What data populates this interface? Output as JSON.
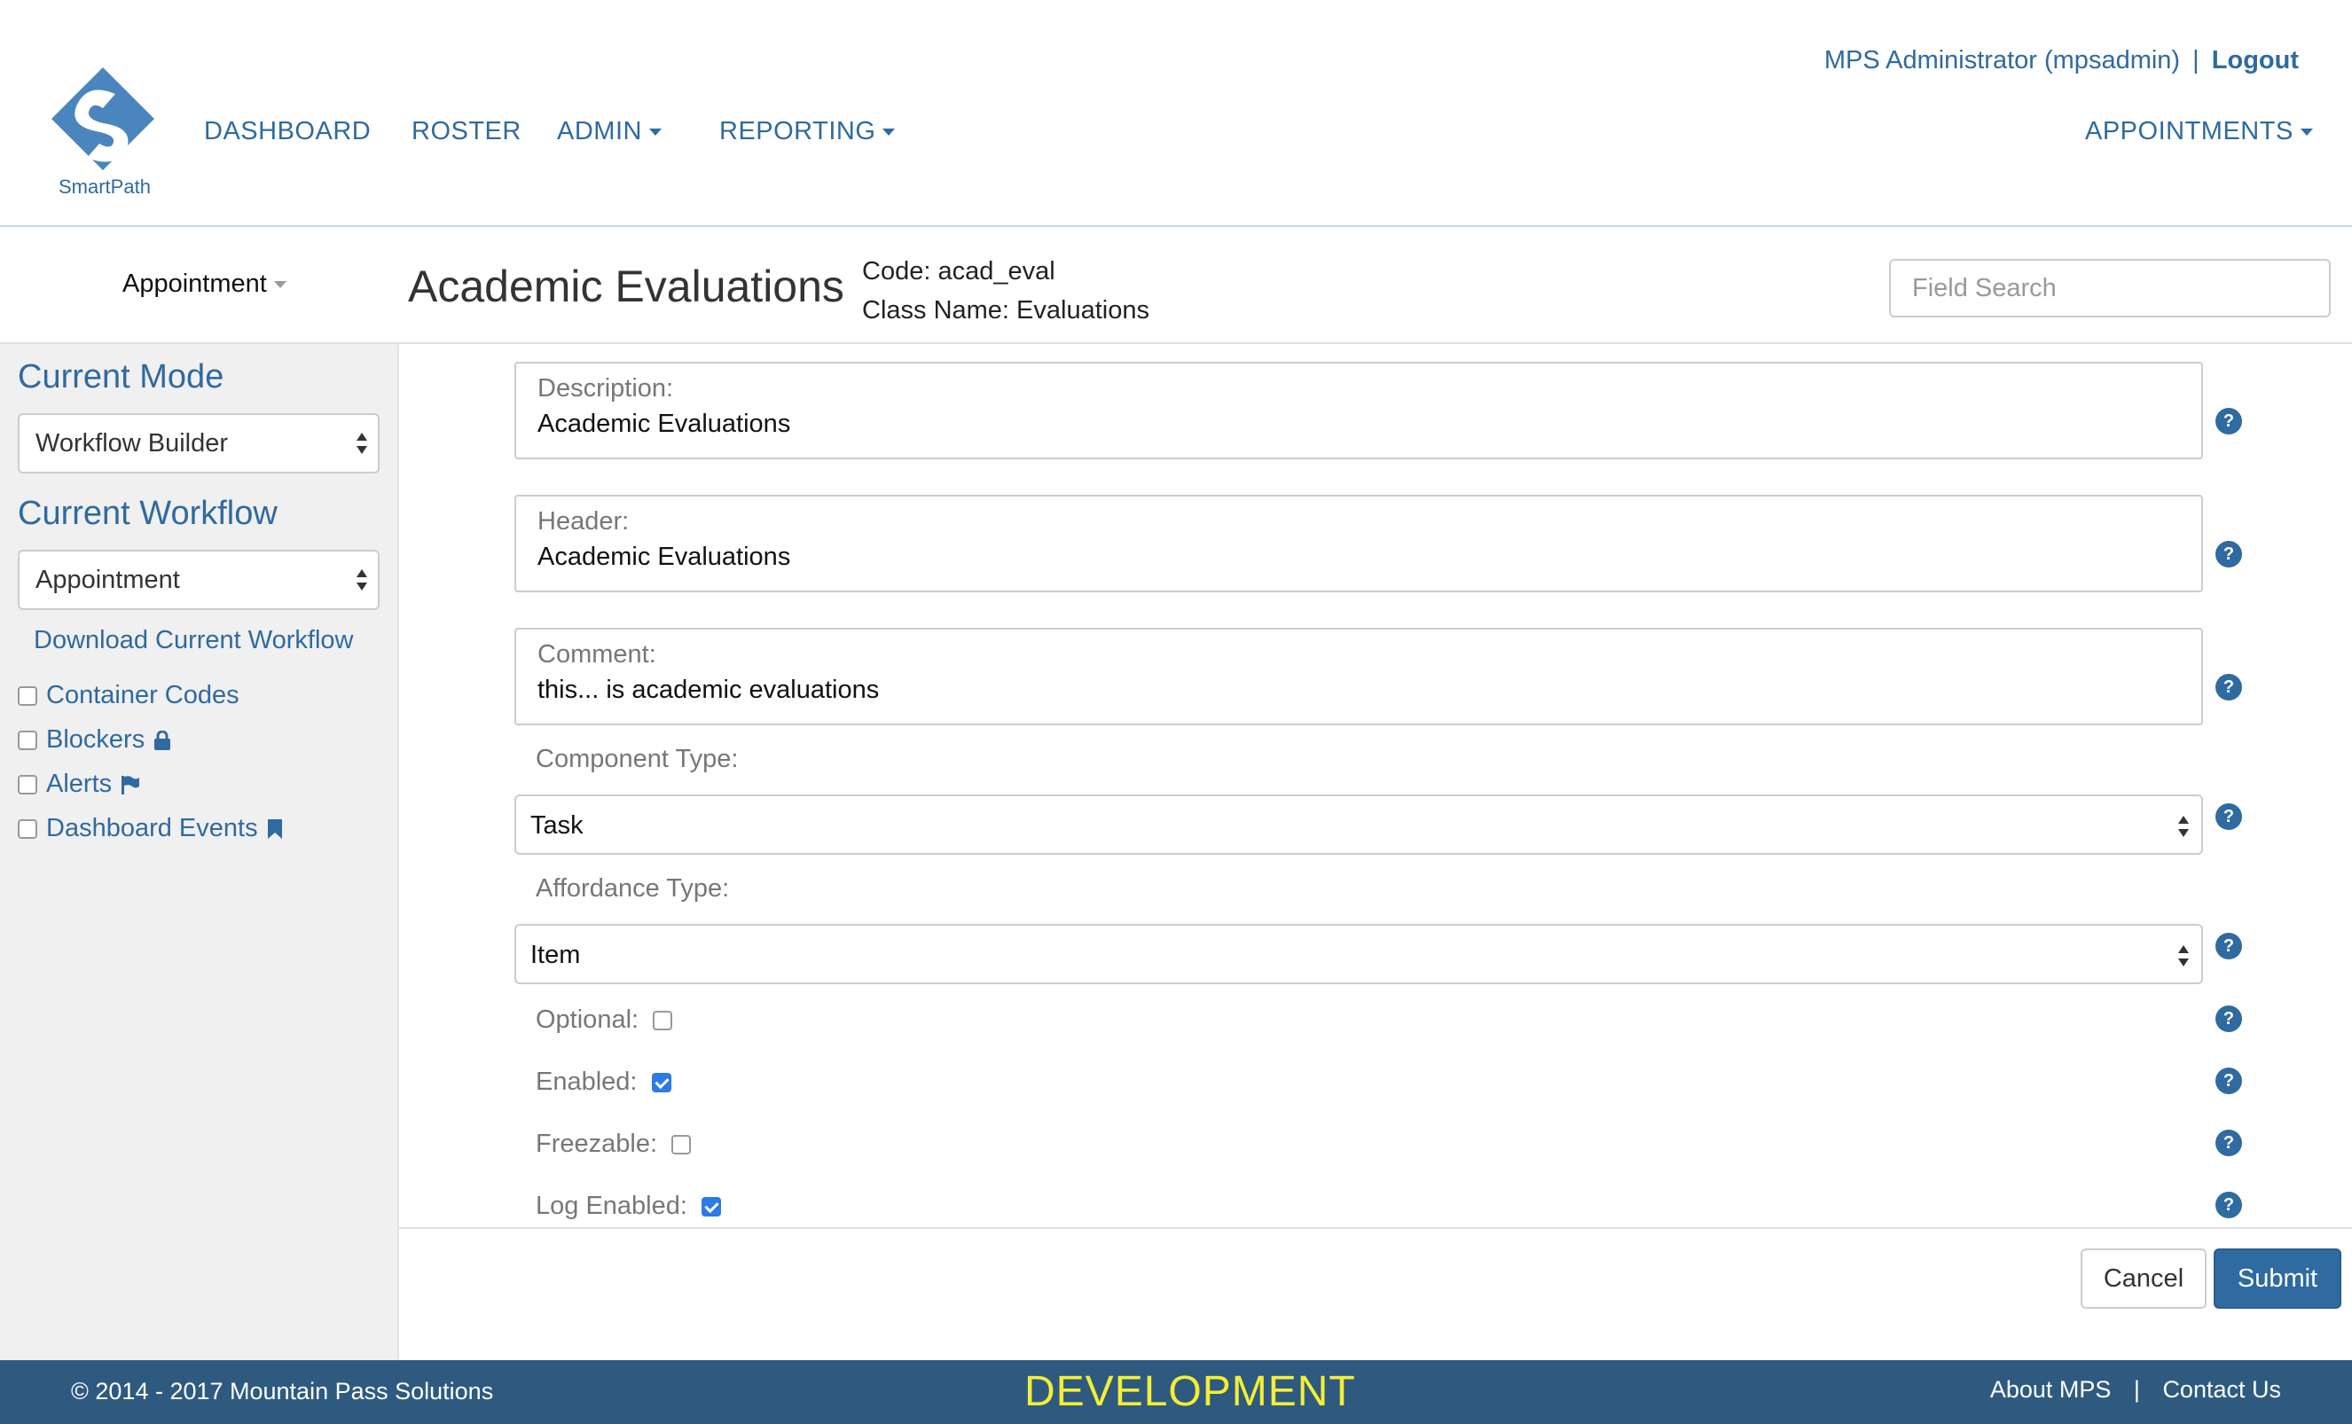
{
  "brand": {
    "name": "SmartPath",
    "color": "#2f6aa0"
  },
  "nav": {
    "items": [
      {
        "label": "DASHBOARD",
        "dropdown": false
      },
      {
        "label": "ROSTER",
        "dropdown": false
      },
      {
        "label": "ADMIN",
        "dropdown": true
      },
      {
        "label": "REPORTING",
        "dropdown": true
      }
    ],
    "right": {
      "label": "APPOINTMENTS",
      "dropdown": true
    }
  },
  "user": {
    "name": "MPS Administrator (mpsadmin)",
    "separator": "|",
    "logout_label": "Logout"
  },
  "subheader": {
    "dropdown_label": "Appointment",
    "title": "Academic Evaluations",
    "code_line": "Code: acad_eval",
    "class_line": "Class Name: Evaluations",
    "search_placeholder": "Field Search"
  },
  "sidebar": {
    "mode_heading": "Current Mode",
    "mode_value": "Workflow Builder",
    "workflow_heading": "Current Workflow",
    "workflow_value": "Appointment",
    "download_label": "Download Current Workflow",
    "checks": [
      {
        "label": "Container Codes",
        "icon": "none",
        "checked": false
      },
      {
        "label": "Blockers",
        "icon": "lock-icon",
        "checked": false
      },
      {
        "label": "Alerts",
        "icon": "flag-icon",
        "checked": false
      },
      {
        "label": "Dashboard Events",
        "icon": "bookmark-icon",
        "checked": false
      }
    ]
  },
  "form": {
    "description": {
      "label": "Description:",
      "value": "Academic Evaluations"
    },
    "header": {
      "label": "Header:",
      "value": "Academic Evaluations"
    },
    "comment": {
      "label": "Comment:",
      "value": "this... is academic evaluations"
    },
    "component_type": {
      "label": "Component Type:",
      "value": "Task"
    },
    "affordance_type": {
      "label": "Affordance Type:",
      "value": "Item"
    },
    "optional": {
      "label": "Optional:",
      "checked": false
    },
    "enabled": {
      "label": "Enabled:",
      "checked": true
    },
    "freezable": {
      "label": "Freezable:",
      "checked": false
    },
    "log_enabled": {
      "label": "Log Enabled:",
      "checked": true
    },
    "help_glyph": "?"
  },
  "actions": {
    "cancel_label": "Cancel",
    "submit_label": "Submit"
  },
  "footer": {
    "copyright": "© 2014 - 2017 Mountain Pass Solutions",
    "environment": "DEVELOPMENT",
    "about_label": "About MPS",
    "separator": "|",
    "contact_label": "Contact Us"
  },
  "colors": {
    "accent": "#2f6aa0",
    "footer_bg": "#2e5a80",
    "environment_text": "#f5ee35",
    "checkbox_checked": "#2c7be5"
  }
}
